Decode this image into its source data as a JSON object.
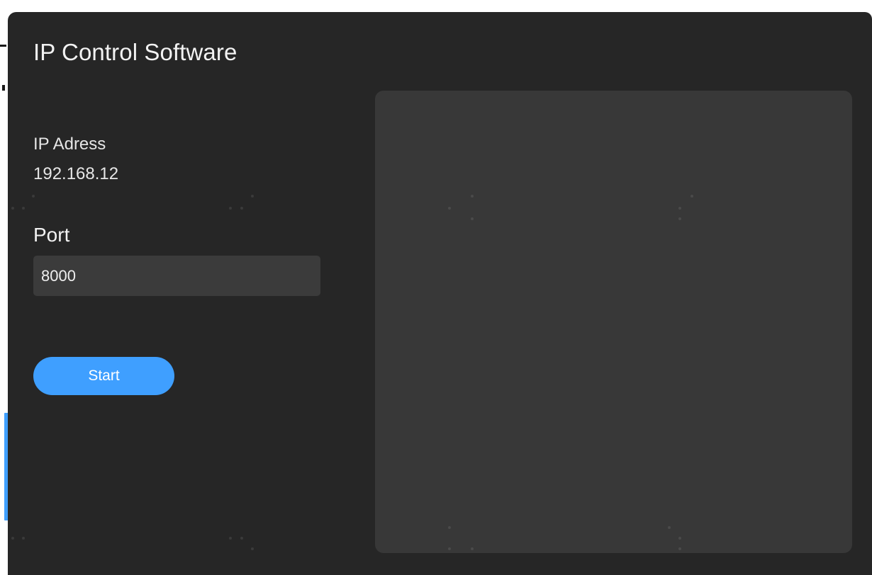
{
  "window": {
    "title": "IP Control Software"
  },
  "ip": {
    "label": "IP Adress",
    "value": "192.168.12"
  },
  "port": {
    "label": "Port",
    "value": "8000"
  },
  "actions": {
    "start_label": "Start"
  },
  "colors": {
    "window_background": "#262626",
    "panel_background": "#383838",
    "input_background": "#3b3b3b",
    "accent": "#3f9fff",
    "text": "#f2f2f2"
  }
}
